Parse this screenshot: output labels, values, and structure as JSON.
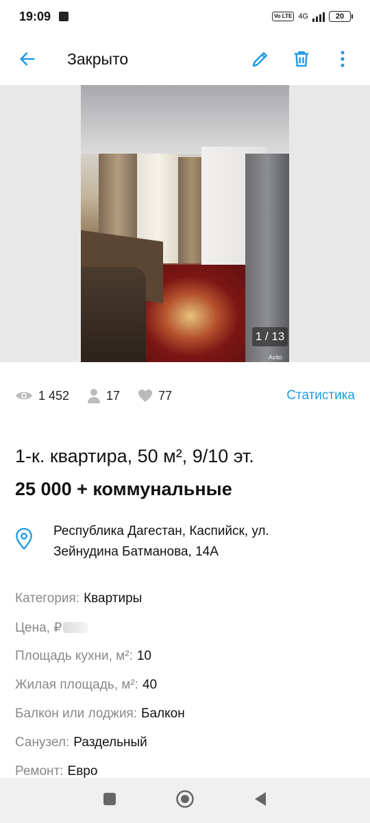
{
  "status_bar": {
    "time": "19:09",
    "network": "4G",
    "battery": "20"
  },
  "toolbar": {
    "title": "Закрыто",
    "back_icon": "arrow-back-icon",
    "edit_icon": "pencil-icon",
    "delete_icon": "trash-icon",
    "more_icon": "more-vertical-icon"
  },
  "gallery": {
    "counter": "1 / 13",
    "watermark": "Avito"
  },
  "stats": {
    "views": "1 452",
    "contacts": "17",
    "favorites": "77",
    "link_label": "Статистика"
  },
  "listing": {
    "title": "1-к. квартира, 50 м², 9/10 эт.",
    "price": "25 000 + коммунальные",
    "address": "Республика Дагестан, Каспийск, ул. Зейнудина Батманова, 14А"
  },
  "params": [
    {
      "label": "Категория:",
      "value": "Квартиры"
    },
    {
      "label": "Цена, ₽",
      "value": ""
    },
    {
      "label": "Площадь кухни, м²:",
      "value": "10"
    },
    {
      "label": "Жилая площадь, м²:",
      "value": "40"
    },
    {
      "label": "Балкон или лоджия:",
      "value": "Балкон"
    },
    {
      "label": "Санузел:",
      "value": "Раздельный"
    },
    {
      "label": "Ремонт:",
      "value": "Евро"
    }
  ],
  "colors": {
    "accent": "#1e9be6",
    "label_gray": "#888888"
  }
}
